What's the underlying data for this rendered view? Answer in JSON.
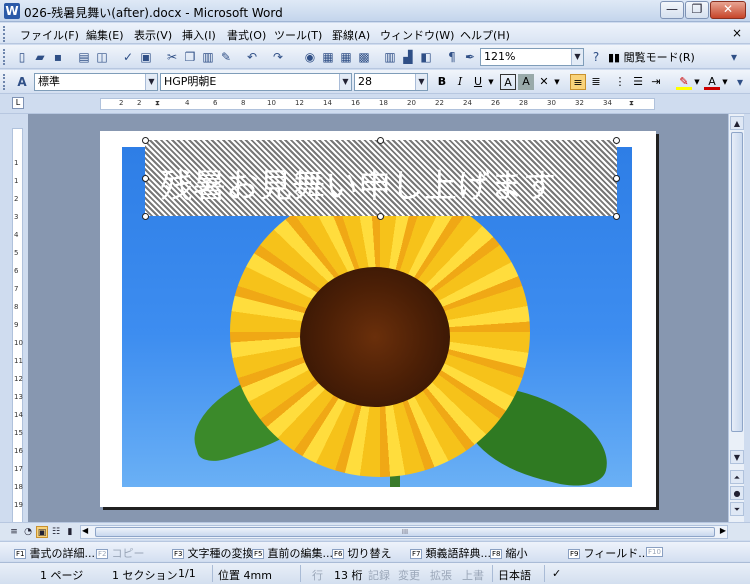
{
  "window": {
    "title": "026-残暑見舞い(after).docx - Microsoft Word",
    "app_icon": "W",
    "buttons": {
      "minimize": "—",
      "restore": "❐",
      "close": "✕"
    }
  },
  "menu": {
    "items": [
      "ファイル(F)",
      "編集(E)",
      "表示(V)",
      "挿入(I)",
      "書式(O)",
      "ツール(T)",
      "罫線(A)",
      "ウィンドウ(W)",
      "ヘルプ(H)"
    ],
    "close_glyph": "×"
  },
  "toolbar_standard": {
    "zoom": "121%",
    "reading_mode": "閲覧モード(R)"
  },
  "toolbar_format": {
    "style": "標準",
    "font": "HGP明朝E",
    "size": "28",
    "bold": "B",
    "italic": "I",
    "underline": "U",
    "char_border": "A",
    "char_shade": "A",
    "font_color": "A"
  },
  "ruler": {
    "h_labels": [
      "2",
      "2",
      "4",
      "6",
      "8",
      "10",
      "12",
      "14",
      "16",
      "18",
      "20",
      "22",
      "24",
      "26",
      "28",
      "30",
      "32",
      "34"
    ],
    "v_labels": [
      "1",
      "1",
      "2",
      "3",
      "4",
      "5",
      "6",
      "7",
      "8",
      "9",
      "10",
      "11",
      "12",
      "13",
      "14",
      "15",
      "16",
      "17",
      "18",
      "19"
    ]
  },
  "document": {
    "headline": "残暑お見舞い申し上げます"
  },
  "hscroll": {
    "thumb_grip": "III"
  },
  "function_keys": [
    {
      "key": "F1",
      "label": "書式の詳細...",
      "enabled": true
    },
    {
      "key": "F2",
      "label": "コピー",
      "enabled": false
    },
    {
      "key": "F3",
      "label": "文字種の変換",
      "enabled": true
    },
    {
      "key": "F5",
      "label": "直前の編集...",
      "enabled": true
    },
    {
      "key": "F6",
      "label": "切り替え",
      "enabled": true
    },
    {
      "key": "F7",
      "label": "類義語辞典...",
      "enabled": true
    },
    {
      "key": "F8",
      "label": "縮小",
      "enabled": true
    },
    {
      "key": "F9",
      "label": "フィールド...",
      "enabled": true
    },
    {
      "key": "F10",
      "label": "",
      "enabled": false
    }
  ],
  "status": {
    "page": "1 ページ",
    "section": "1 セクション",
    "page_of": "1/1",
    "position": "位置 4mm",
    "line_label": "行",
    "line": "13 桁",
    "rec": "記録",
    "trk": "変更",
    "ext": "拡張",
    "ovr": "上書",
    "language": "日本語"
  },
  "colors": {
    "accent": "#f9d37a",
    "sky": "#3d8df0",
    "petal": "#f6c21a"
  }
}
